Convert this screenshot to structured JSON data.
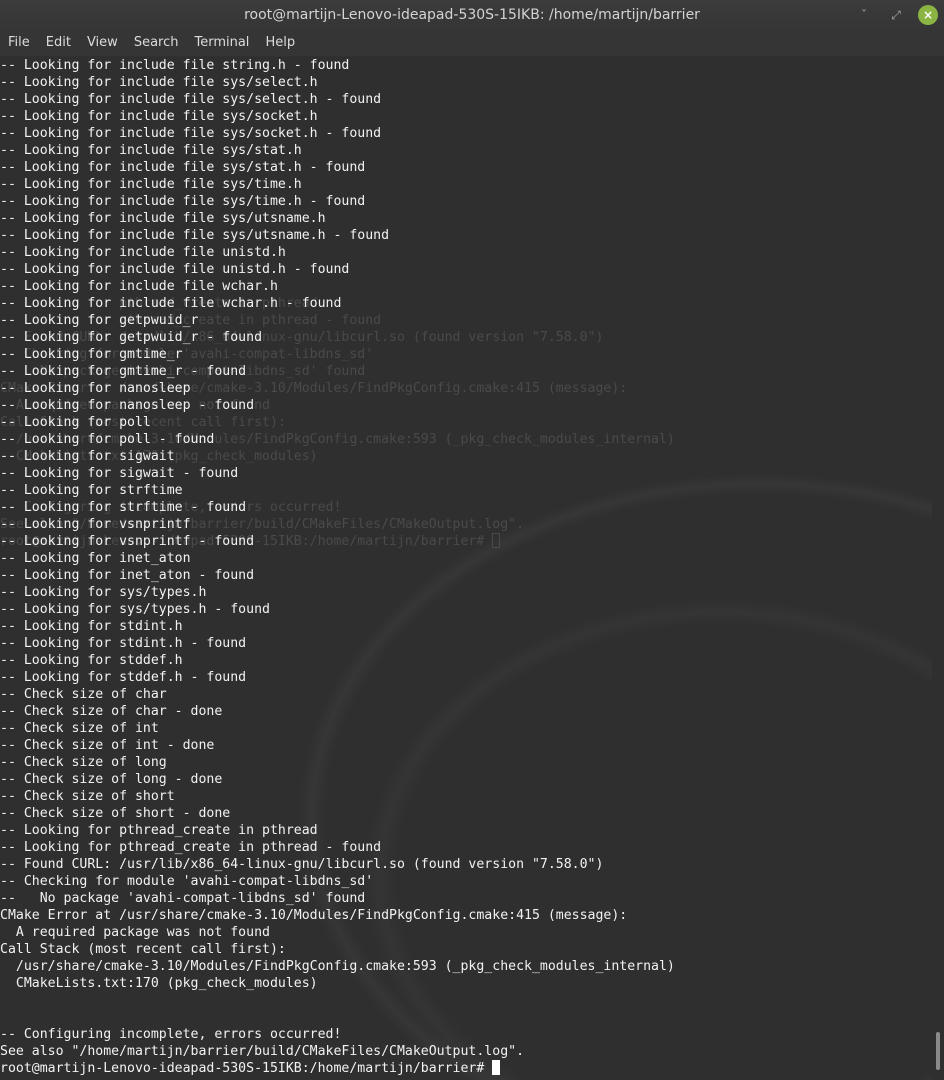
{
  "window": {
    "title": "root@martijn-Lenovo-ideapad-530S-15IKB: /home/martijn/barrier",
    "controls": {
      "minimize": "ˇ",
      "maximize": "⤢",
      "close": "×"
    }
  },
  "menubar": {
    "items": [
      "File",
      "Edit",
      "View",
      "Search",
      "Terminal",
      "Help"
    ]
  },
  "terminal": {
    "lines": [
      "-- Looking for include file string.h - found",
      "-- Looking for include file sys/select.h",
      "-- Looking for include file sys/select.h - found",
      "-- Looking for include file sys/socket.h",
      "-- Looking for include file sys/socket.h - found",
      "-- Looking for include file sys/stat.h",
      "-- Looking for include file sys/stat.h - found",
      "-- Looking for include file sys/time.h",
      "-- Looking for include file sys/time.h - found",
      "-- Looking for include file sys/utsname.h",
      "-- Looking for include file sys/utsname.h - found",
      "-- Looking for include file unistd.h",
      "-- Looking for include file unistd.h - found",
      "-- Looking for include file wchar.h",
      "-- Looking for include file wchar.h - found",
      "-- Looking for getpwuid_r",
      "-- Looking for getpwuid_r - found",
      "-- Looking for gmtime_r",
      "-- Looking for gmtime_r - found",
      "-- Looking for nanosleep",
      "-- Looking for nanosleep - found",
      "-- Looking for poll",
      "-- Looking for poll - found",
      "-- Looking for sigwait",
      "-- Looking for sigwait - found",
      "-- Looking for strftime",
      "-- Looking for strftime - found",
      "-- Looking for vsnprintf",
      "-- Looking for vsnprintf - found",
      "-- Looking for inet_aton",
      "-- Looking for inet_aton - found",
      "-- Looking for sys/types.h",
      "-- Looking for sys/types.h - found",
      "-- Looking for stdint.h",
      "-- Looking for stdint.h - found",
      "-- Looking for stddef.h",
      "-- Looking for stddef.h - found",
      "-- Check size of char",
      "-- Check size of char - done",
      "-- Check size of int",
      "-- Check size of int - done",
      "-- Check size of long",
      "-- Check size of long - done",
      "-- Check size of short",
      "-- Check size of short - done",
      "-- Looking for pthread_create in pthread",
      "-- Looking for pthread_create in pthread - found",
      "-- Found CURL: /usr/lib/x86_64-linux-gnu/libcurl.so (found version \"7.58.0\")",
      "-- Checking for module 'avahi-compat-libdns_sd'",
      "--   No package 'avahi-compat-libdns_sd' found",
      "CMake Error at /usr/share/cmake-3.10/Modules/FindPkgConfig.cmake:415 (message):",
      "  A required package was not found",
      "Call Stack (most recent call first):",
      "  /usr/share/cmake-3.10/Modules/FindPkgConfig.cmake:593 (_pkg_check_modules_internal)",
      "  CMakeLists.txt:170 (pkg_check_modules)",
      "",
      "",
      "-- Configuring incomplete, errors occurred!",
      "See also \"/home/martijn/barrier/build/CMakeFiles/CMakeOutput.log\".",
      "root@martijn-Lenovo-ideapad-530S-15IKB:/home/martijn/barrier# "
    ],
    "ghost_lines": [
      "",
      "",
      "",
      "",
      "",
      "",
      "",
      "",
      "",
      "",
      "",
      "",
      "",
      "",
      "-- Looking for pthread_create in pthread",
      "-- Looking for pthread_create in pthread - found",
      "-- Found CURL: /usr/lib/x86_64-linux-gnu/libcurl.so (found version \"7.58.0\")",
      "-- Checking for module 'avahi-compat-libdns_sd'",
      "--   No package 'avahi-compat-libdns_sd' found",
      "CMake Error at /usr/share/cmake-3.10/Modules/FindPkgConfig.cmake:415 (message):",
      "  A required package was not found",
      "Call Stack (most recent call first):",
      "  /usr/share/cmake-3.10/Modules/FindPkgConfig.cmake:593 (_pkg_check_modules_internal)",
      "  CMakeLists.txt:170 (pkg_check_modules)",
      "",
      "",
      "-- Configuring incomplete, errors occurred!",
      "See also \"/home/martijn/barrier/build/CMakeFiles/CMakeOutput.log\".",
      "root@martijn-Lenovo-ideapad-530S-15IKB:/home/martijn/barrier# "
    ]
  },
  "colors": {
    "terminal_bg": "#2f2f2f",
    "text": "#f2f2f2",
    "close_button": "#8ab543"
  }
}
